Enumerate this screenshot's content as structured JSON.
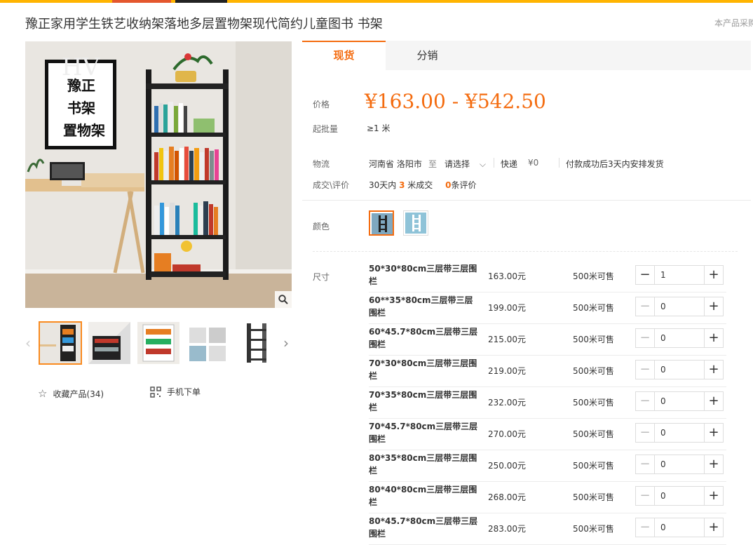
{
  "title": "豫正家用学生铁艺收纳架落地多层置物架现代简约儿童图书 书架",
  "corner_note": "本产品采购",
  "poster_text": [
    "豫正",
    "书架",
    "置物架"
  ],
  "poster_watermark": "HV",
  "tabs": [
    "现货",
    "分销"
  ],
  "price": {
    "label": "价格",
    "value": "¥163.00 - ¥542.50"
  },
  "moq": {
    "label": "起批量",
    "value": "≥1 米"
  },
  "logistics": {
    "label": "物流",
    "origin": "河南省 洛阳市",
    "to": "至",
    "destination": "请选择",
    "method": "快递",
    "fee": "¥0",
    "note": "付款成功后3天内安排发货"
  },
  "deals": {
    "label": "成交\\评价",
    "prefix": "30天内",
    "count": "3",
    "count_suffix": "米成交",
    "reviews": "0",
    "reviews_suffix": "条评价"
  },
  "color": {
    "label": "颜色"
  },
  "size": {
    "label": "尺寸"
  },
  "favorite": {
    "label": "收藏产品(34)"
  },
  "mobile_order": {
    "label": "手机下单"
  },
  "skus": [
    {
      "name": "50*30*80cm三层带三层围栏",
      "price": "163.00元",
      "stock": "500米可售",
      "qty": "1"
    },
    {
      "name": "60**35*80cm三层带三层围栏",
      "price": "199.00元",
      "stock": "500米可售",
      "qty": "0"
    },
    {
      "name": "60*45.7*80cm三层带三层围栏",
      "price": "215.00元",
      "stock": "500米可售",
      "qty": "0"
    },
    {
      "name": "70*30*80cm三层带三层围栏",
      "price": "219.00元",
      "stock": "500米可售",
      "qty": "0"
    },
    {
      "name": "70*35*80cm三层带三层围栏",
      "price": "232.00元",
      "stock": "500米可售",
      "qty": "0"
    },
    {
      "name": "70*45.7*80cm三层带三层围栏",
      "price": "270.00元",
      "stock": "500米可售",
      "qty": "0"
    },
    {
      "name": "80*35*80cm三层带三层围栏",
      "price": "250.00元",
      "stock": "500米可售",
      "qty": "0"
    },
    {
      "name": "80*40*80cm三层带三层围栏",
      "price": "268.00元",
      "stock": "500米可售",
      "qty": "0"
    },
    {
      "name": "80*45.7*80cm三层带三层围栏",
      "price": "283.00元",
      "stock": "500米可售",
      "qty": "0"
    }
  ],
  "accent_color": "#f46c10"
}
